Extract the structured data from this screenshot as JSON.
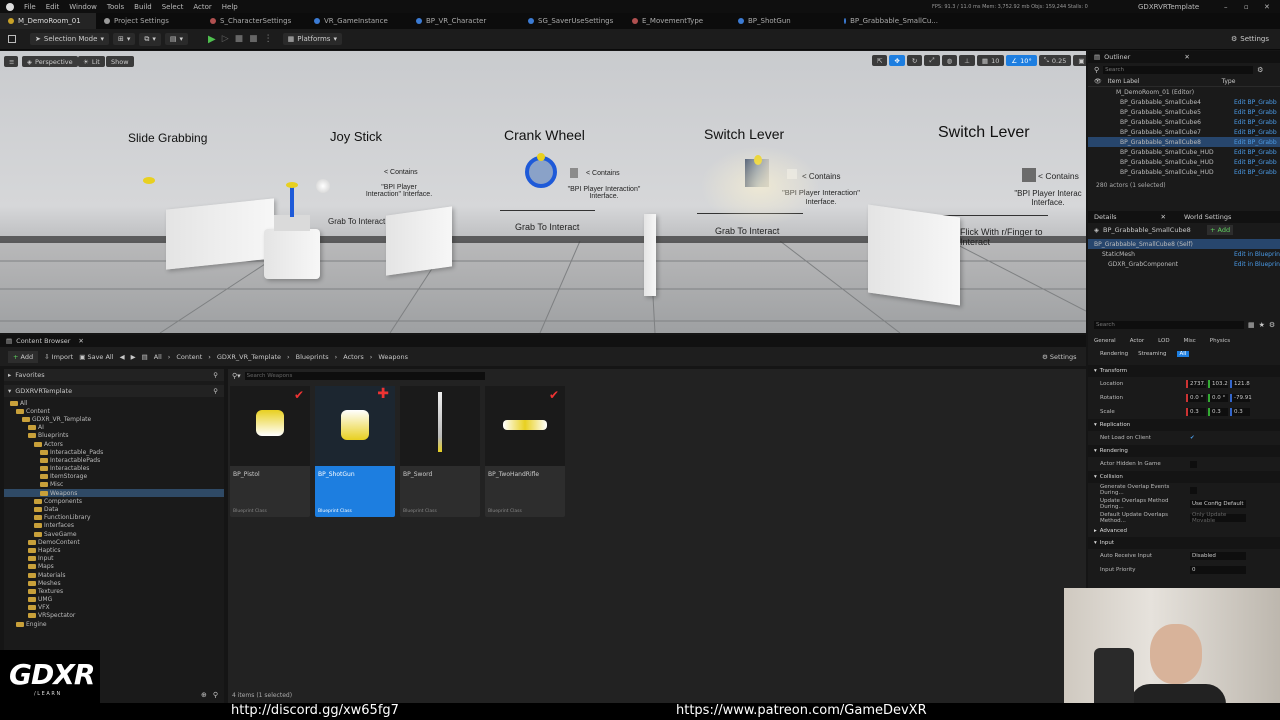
{
  "menu": [
    "File",
    "Edit",
    "Window",
    "Tools",
    "Build",
    "Select",
    "Actor",
    "Help"
  ],
  "window_title": "GDXRVRTemplate",
  "stats": "FPS: 91.3 / 11.0 ms  Mem: 3,752.92 mb  Objs: 159,244  Stalls: 0",
  "tabs": [
    {
      "label": "M_DemoRoom_01",
      "color": "#c9a227"
    },
    {
      "label": "Project Settings",
      "color": "#999999"
    },
    {
      "label": "S_CharacterSettings",
      "color": "#b05050"
    },
    {
      "label": "VR_GameInstance",
      "color": "#3b7bd4"
    },
    {
      "label": "BP_VR_Character",
      "color": "#3b7bd4"
    },
    {
      "label": "SG_SaverUseSettings",
      "color": "#3b7bd4"
    },
    {
      "label": "E_MovementType",
      "color": "#b05050"
    },
    {
      "label": "BP_ShotGun",
      "color": "#3b7bd4"
    },
    {
      "label": "BP_Grabbable_SmallCu...",
      "color": "#3b7bd4"
    }
  ],
  "toolbar": {
    "mode": "Selection Mode",
    "platforms": "Platforms",
    "settings": "Settings"
  },
  "viewport": {
    "perspective": "Perspective",
    "lit": "Lit",
    "show": "Show",
    "fov": "0.25",
    "grid": "10",
    "angle": "10°",
    "cam": "4",
    "labels": {
      "slide": "Slide Grabbing",
      "joy": "Joy Stick",
      "crank": "Crank Wheel",
      "switch1": "Switch Lever",
      "switch2": "Switch Lever"
    },
    "contains": "< Contains",
    "bpi": "\"BPI Player Interaction\" Interface.",
    "bpi2": "\"BPI Player Interac Interface.",
    "grab": "Grab To Interact",
    "flick": "Flick With r/Finger to Interact"
  },
  "outliner": {
    "title": "Outliner",
    "search": "Search",
    "col_label": "Item Label",
    "col_type": "Type",
    "root": "M_DemoRoom_01 (Editor)",
    "items": [
      {
        "label": "BP_Grabbable_SmallCube4",
        "type": "Edit BP_Grabb"
      },
      {
        "label": "BP_Grabbable_SmallCube5",
        "type": "Edit BP_Grabb"
      },
      {
        "label": "BP_Grabbable_SmallCube6",
        "type": "Edit BP_Grabb"
      },
      {
        "label": "BP_Grabbable_SmallCube7",
        "type": "Edit BP_Grabb"
      },
      {
        "label": "BP_Grabbable_SmallCube8",
        "type": "Edit BP_Grabb"
      },
      {
        "label": "BP_Grabbable_SmallCube_HUD",
        "type": "Edit BP_Grabb"
      },
      {
        "label": "BP_Grabbable_SmallCube_HUD",
        "type": "Edit BP_Grabb"
      },
      {
        "label": "BP_Grabbable_SmallCube_HUD",
        "type": "Edit BP_Grabb"
      }
    ],
    "footer": "280 actors (1 selected)"
  },
  "details": {
    "tab": "Details",
    "tab2": "World Settings",
    "actor": "BP_Grabbable_SmallCube8",
    "add": "+ Add",
    "self": "BP_Grabbable_SmallCube8 (Self)",
    "components": [
      {
        "name": "StaticMesh",
        "link": "Edit in Blueprint"
      },
      {
        "name": "GDXR_GrabComponent",
        "link": "Edit in Blueprint"
      }
    ],
    "search": "Search",
    "filters1": [
      "General",
      "Actor",
      "LOD",
      "Misc",
      "Physics"
    ],
    "filters2": [
      "Rendering",
      "Streaming",
      "All"
    ],
    "transform": "Transform",
    "location": {
      "label": "Location",
      "x": "2737.",
      "y": "103.2",
      "z": "121.8"
    },
    "rotation": {
      "label": "Rotation",
      "x": "0.0 °",
      "y": "0.0 °",
      "z": "-79.91"
    },
    "scale": {
      "label": "Scale",
      "x": "0.3",
      "y": "0.3",
      "z": "0.3"
    },
    "replication": "Replication",
    "net_load": "Net Load on Client",
    "rendering": "Rendering",
    "hidden": "Actor Hidden In Game",
    "collision": "Collision",
    "overlap": "Generate Overlap Events During...",
    "update": "Update Overlaps Method During...",
    "update_val": "Use Config Default",
    "default_update": "Default Update Overlaps Method...",
    "default_val": "Only Update Movable",
    "advanced": "Advanced",
    "input": "Input",
    "auto": "Auto Receive Input",
    "auto_val": "Disabled",
    "priority": "Input Priority",
    "priority_val": "0"
  },
  "content": {
    "title": "Content Browser",
    "add": "Add",
    "import": "Import",
    "save": "Save All",
    "path": [
      "All",
      "Content",
      "GDXR_VR_Template",
      "Blueprints",
      "Actors",
      "Weapons"
    ],
    "settings": "Settings",
    "favorites": "Favorites",
    "root": "GDXRVRTemplate",
    "search": "Search Weapons",
    "tree": [
      {
        "l": "All",
        "d": 0
      },
      {
        "l": "Content",
        "d": 1
      },
      {
        "l": "GDXR_VR_Template",
        "d": 2
      },
      {
        "l": "AI",
        "d": 3
      },
      {
        "l": "Blueprints",
        "d": 3
      },
      {
        "l": "Actors",
        "d": 4
      },
      {
        "l": "Interactable_Pads",
        "d": 5
      },
      {
        "l": "InteractablePads",
        "d": 5
      },
      {
        "l": "Interactables",
        "d": 5
      },
      {
        "l": "ItemStorage",
        "d": 5
      },
      {
        "l": "Misc",
        "d": 5
      },
      {
        "l": "Weapons",
        "d": 5
      },
      {
        "l": "Components",
        "d": 4
      },
      {
        "l": "Data",
        "d": 4
      },
      {
        "l": "FunctionLibrary",
        "d": 4
      },
      {
        "l": "Interfaces",
        "d": 4
      },
      {
        "l": "SaveGame",
        "d": 4
      },
      {
        "l": "DemoContent",
        "d": 3
      },
      {
        "l": "Haptics",
        "d": 3
      },
      {
        "l": "Input",
        "d": 3
      },
      {
        "l": "Maps",
        "d": 3
      },
      {
        "l": "Materials",
        "d": 3
      },
      {
        "l": "Meshes",
        "d": 3
      },
      {
        "l": "Textures",
        "d": 3
      },
      {
        "l": "UMG",
        "d": 3
      },
      {
        "l": "VFX",
        "d": 3
      },
      {
        "l": "VRSpectator",
        "d": 3
      },
      {
        "l": "Engine",
        "d": 1
      }
    ],
    "assets": [
      {
        "name": "BP_Pistol",
        "cls": "Blueprint Class"
      },
      {
        "name": "BP_ShotGun",
        "cls": "Blueprint Class"
      },
      {
        "name": "BP_Sword",
        "cls": "Blueprint Class"
      },
      {
        "name": "BP_TwoHandRifle",
        "cls": "Blueprint Class"
      }
    ],
    "status": "4 items (1 selected)"
  },
  "overlay": {
    "logo": "GDXR",
    "logo_sub": "/ L E A R N",
    "discord": "http://discord.gg/xw65fg7",
    "patreon": "https://www.patreon.com/GameDevXR"
  }
}
